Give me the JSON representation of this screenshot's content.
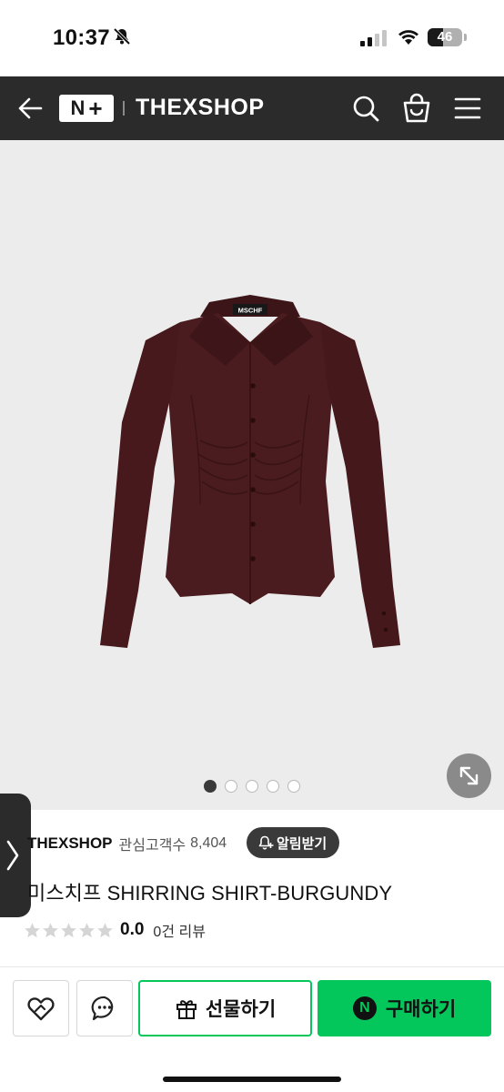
{
  "status_bar": {
    "time": "10:37",
    "battery": "46"
  },
  "header": {
    "brand": "THEXSHOP",
    "logo_text": "N",
    "logo_plus": "+"
  },
  "gallery": {
    "image_count": 5,
    "active_index": 0,
    "garment_label": "MSCHF"
  },
  "seller": {
    "name": "THEXSHOP",
    "follow_label": "관심고객수",
    "follow_count": "8,404",
    "notify_label": "알림받기"
  },
  "product": {
    "title": "미스치프 SHIRRING SHIRT-BURGUNDY"
  },
  "rating": {
    "stars": 0,
    "max_stars": 5,
    "score": "0.0",
    "review_count": "0건 리뷰"
  },
  "actions": {
    "gift_label": "선물하기",
    "buy_label": "구매하기",
    "npay_mark": "N"
  },
  "colors": {
    "header_bg": "#2b2b2b",
    "accent_green": "#03c75a",
    "garment": "#4a1c1f"
  },
  "icons": [
    "bell-off-icon",
    "signal-icon",
    "wifi-icon",
    "battery-icon",
    "back-arrow-icon",
    "search-icon",
    "shopping-bag-icon",
    "menu-icon",
    "expand-icon",
    "chevron-right-icon",
    "bell-plus-icon",
    "star-icon",
    "heart-icon",
    "chat-icon",
    "gift-icon"
  ]
}
